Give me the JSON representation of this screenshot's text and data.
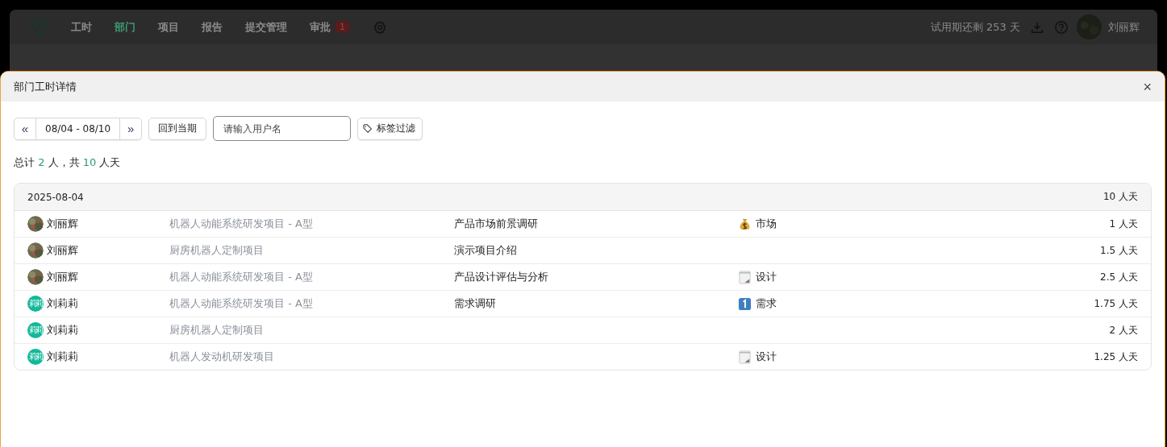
{
  "nav": {
    "items": [
      {
        "label": "工时",
        "selected": false
      },
      {
        "label": "部门",
        "selected": true
      },
      {
        "label": "项目",
        "selected": false
      },
      {
        "label": "报告",
        "selected": false
      },
      {
        "label": "提交管理",
        "selected": false
      },
      {
        "label": "审批",
        "selected": false,
        "badge": "1"
      }
    ],
    "trial": "试用期还剩 253 天",
    "user": "刘丽辉"
  },
  "dialog": {
    "title": "部门工时详情",
    "close": "×",
    "toolbar": {
      "prev": "«",
      "range": "08/04 - 08/10",
      "next": "»",
      "current": "回到当期",
      "search": {
        "placeholder": "请输入用户名"
      },
      "filter": "标签过滤"
    },
    "summary": {
      "prefix": "总计",
      "people": "2",
      "middle": "人，共",
      "days": "10",
      "suffix": "人天"
    },
    "groups": [
      {
        "date": "2025-08-04",
        "total": "10 人天",
        "rows": [
          {
            "avatar": {
              "kind": "photo"
            },
            "user": "刘丽辉",
            "project": "机器人动能系统研发项目 - A型",
            "task": "产品市场前景调研",
            "tag": {
              "kind": "money",
              "label": "市场"
            },
            "days": "1 人天"
          },
          {
            "avatar": {
              "kind": "photo"
            },
            "user": "刘丽辉",
            "project": "厨房机器人定制项目",
            "task": "演示项目介绍",
            "days": "1.5 人天"
          },
          {
            "avatar": {
              "kind": "photo"
            },
            "user": "刘丽辉",
            "project": "机器人动能系统研发项目 - A型",
            "task": "产品设计评估与分析",
            "tag": {
              "kind": "memo",
              "label": "设计"
            },
            "days": "2.5 人天"
          },
          {
            "avatar": {
              "kind": "initials",
              "text": "莉莉"
            },
            "user": "刘莉莉",
            "project": "机器人动能系统研发项目 - A型",
            "task": "需求调研",
            "tag": {
              "kind": "one",
              "label": "需求"
            },
            "days": "1.75 人天"
          },
          {
            "avatar": {
              "kind": "initials",
              "text": "莉莉"
            },
            "user": "刘莉莉",
            "project": "厨房机器人定制项目",
            "days": "2 人天"
          },
          {
            "avatar": {
              "kind": "initials",
              "text": "莉莉"
            },
            "user": "刘莉莉",
            "project": "机器人发动机研发项目",
            "tag": {
              "kind": "memo",
              "label": "设计"
            },
            "days": "1.25 人天"
          }
        ]
      }
    ]
  }
}
